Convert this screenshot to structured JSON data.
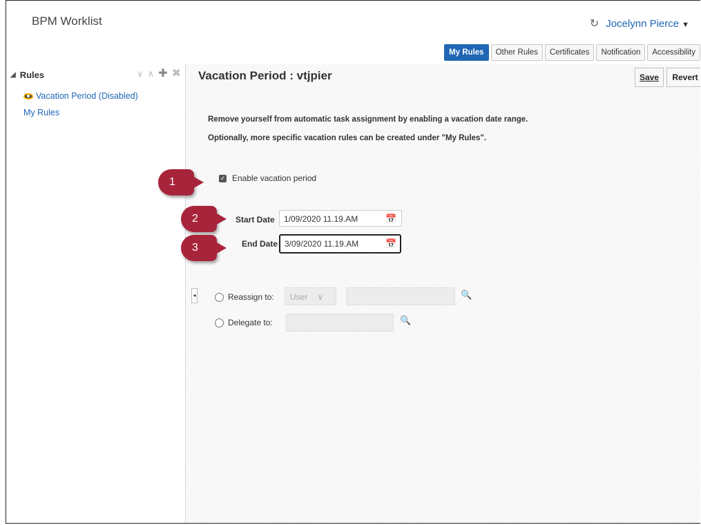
{
  "header": {
    "app_title": "BPM Worklist",
    "user_name": "Jocelynn Pierce",
    "user_caret": "▼"
  },
  "tabs": [
    {
      "label": "My Rules",
      "active": true
    },
    {
      "label": "Other Rules",
      "active": false
    },
    {
      "label": "Certificates",
      "active": false
    },
    {
      "label": "Notification",
      "active": false
    },
    {
      "label": "Accessibility",
      "active": false
    }
  ],
  "sidebar": {
    "title": "Rules",
    "items": [
      {
        "label": "Vacation Period (Disabled)",
        "icon": "eye-icon"
      },
      {
        "label": "My Rules"
      }
    ]
  },
  "main": {
    "title": "Vacation Period : vtjpier",
    "save_label": "Save",
    "revert_label": "Revert",
    "description_1": "Remove yourself from automatic task assignment by enabling a vacation date range.",
    "description_2": "Optionally, more specific vacation rules can be created under \"My Rules\".",
    "enable_label": "Enable vacation period",
    "enable_checked": true,
    "start_date_label": "Start Date",
    "start_date_value": "1/09/2020 11.19.AM",
    "end_date_label": "End Date",
    "end_date_value": "3/09/2020 11.19.AM",
    "reassign_label": "Reassign to:",
    "reassign_type": "User",
    "delegate_label": "Delegate to:"
  },
  "callouts": [
    "1",
    "2",
    "3"
  ],
  "colors": {
    "accent": "#1f66b4",
    "callout": "#a8243b"
  }
}
